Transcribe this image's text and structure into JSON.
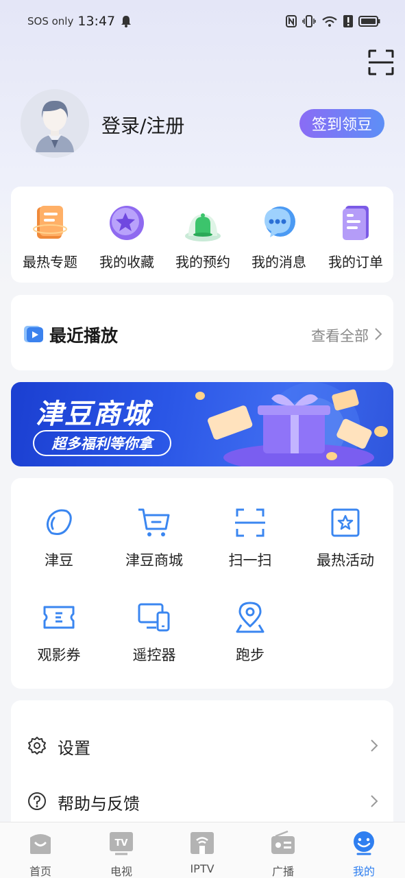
{
  "status_bar": {
    "carrier": "SOS only",
    "time": "13:47"
  },
  "profile": {
    "login_label": "登录/注册",
    "checkin_label": "签到领豆"
  },
  "quick_links": [
    {
      "label": "最热专题",
      "icon": "hot-topic-book-icon"
    },
    {
      "label": "我的收藏",
      "icon": "star-favorite-icon"
    },
    {
      "label": "我的预约",
      "icon": "bell-reservation-icon"
    },
    {
      "label": "我的消息",
      "icon": "chat-message-icon"
    },
    {
      "label": "我的订单",
      "icon": "order-list-icon"
    }
  ],
  "recent": {
    "title": "最近播放",
    "view_all": "查看全部"
  },
  "banner": {
    "title": "津豆商城",
    "subtitle": "超多福利等你拿"
  },
  "services": [
    {
      "label": "津豆",
      "icon": "bean-icon"
    },
    {
      "label": "津豆商城",
      "icon": "cart-icon"
    },
    {
      "label": "扫一扫",
      "icon": "scan-icon"
    },
    {
      "label": "最热活动",
      "icon": "star-box-icon"
    },
    {
      "label": "观影券",
      "icon": "ticket-icon"
    },
    {
      "label": "遥控器",
      "icon": "remote-devices-icon"
    },
    {
      "label": "跑步",
      "icon": "location-pin-icon"
    }
  ],
  "settings": [
    {
      "label": "设置",
      "icon": "gear-icon"
    },
    {
      "label": "帮助与反馈",
      "icon": "help-icon"
    }
  ],
  "tabs": [
    {
      "label": "首页",
      "icon": "home-icon"
    },
    {
      "label": "电视",
      "icon": "tv-icon"
    },
    {
      "label": "IPTV",
      "icon": "iptv-icon"
    },
    {
      "label": "广播",
      "icon": "radio-icon"
    },
    {
      "label": "我的",
      "icon": "mine-icon",
      "active": true
    }
  ],
  "colors": {
    "accent": "#2f7ff0",
    "checkin_gradient_start": "#8a6cf5",
    "checkin_gradient_end": "#5d8ff6",
    "icon_blue": "#3a86f0"
  }
}
